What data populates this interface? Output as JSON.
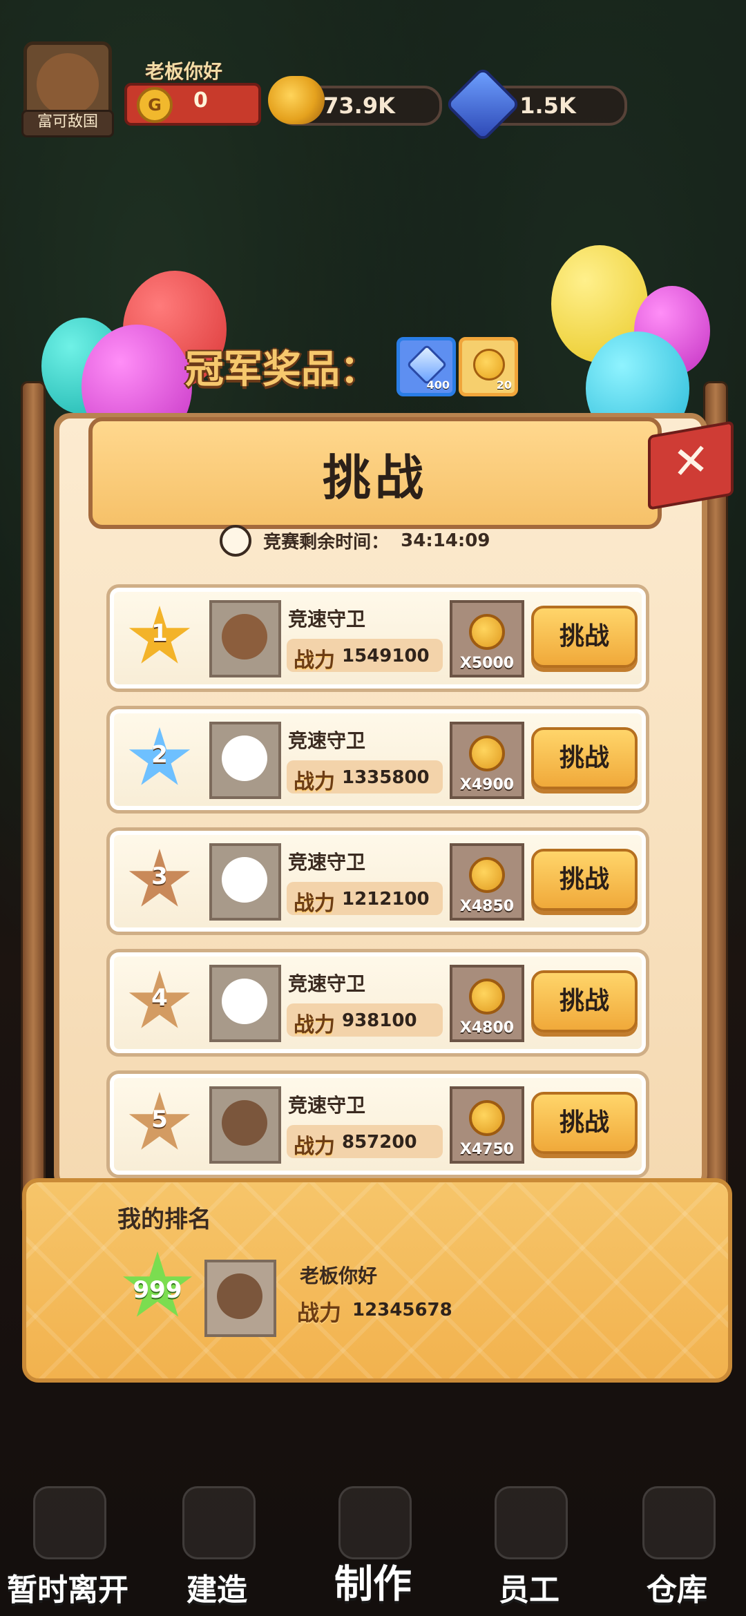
{
  "hud": {
    "avatar_label": "富可敌国",
    "player_name": "老板你好",
    "gold_small_icon": "G",
    "gold_small_value": "0",
    "coins_value": "73.9K",
    "gems_value": "1.5K"
  },
  "prize": {
    "title": "冠军奖品：",
    "items": [
      {
        "icon": "diamond-icon",
        "amount": "400"
      },
      {
        "icon": "gold-token-icon",
        "amount": "20"
      }
    ]
  },
  "panel": {
    "title": "挑战",
    "close_symbol": "✕",
    "timer_label": "竞赛剩余时间：",
    "timer_value": "34:14:09"
  },
  "rows": [
    {
      "rank": "1",
      "name": "竞速守卫",
      "power_label": "战力",
      "power": "1549100",
      "reward": "X5000",
      "button": "挑战"
    },
    {
      "rank": "2",
      "name": "竞速守卫",
      "power_label": "战力",
      "power": "1335800",
      "reward": "X4900",
      "button": "挑战"
    },
    {
      "rank": "3",
      "name": "竞速守卫",
      "power_label": "战力",
      "power": "1212100",
      "reward": "X4850",
      "button": "挑战"
    },
    {
      "rank": "4",
      "name": "竞速守卫",
      "power_label": "战力",
      "power": "938100",
      "reward": "X4800",
      "button": "挑战"
    },
    {
      "rank": "5",
      "name": "竞速守卫",
      "power_label": "战力",
      "power": "857200",
      "reward": "X4750",
      "button": "挑战"
    }
  ],
  "my_rank": {
    "title": "我的排名",
    "rank": "999",
    "name": "老板你好",
    "power_label": "战力",
    "power": "12345678"
  },
  "bottom_nav": [
    {
      "label": "暂时离开",
      "icon": "exit-door-icon"
    },
    {
      "label": "建造",
      "icon": "hammer-icon"
    },
    {
      "label": "制作",
      "icon": "cooking-pot-icon"
    },
    {
      "label": "员工",
      "icon": "staff-icon"
    },
    {
      "label": "仓库",
      "icon": "chest-icon"
    }
  ]
}
